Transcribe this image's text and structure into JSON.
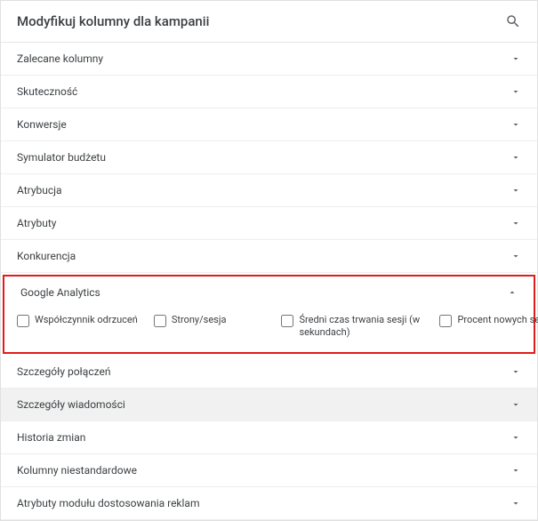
{
  "header": {
    "title": "Modyfikuj kolumny dla kampanii"
  },
  "sections": {
    "zalecane": "Zalecane kolumny",
    "skutecznosc": "Skuteczność",
    "konwersje": "Konwersje",
    "symulator": "Symulator budżetu",
    "atrybucja": "Atrybucja",
    "atrybuty": "Atrybuty",
    "konkurencja": "Konkurencja",
    "ga": "Google Analytics",
    "szczegoly_polaczen": "Szczegóły połączeń",
    "szczegoly_wiadomosci": "Szczegóły wiadomości",
    "historia": "Historia zmian",
    "kolumny_niestandardowe": "Kolumny niestandardowe",
    "atrybuty_modulu": "Atrybuty modułu dostosowania reklam"
  },
  "ga_options": {
    "opt1": "Współczynnik odrzuceń",
    "opt2": "Strony/sesja",
    "opt3": "Średni czas trwania sesji (w sekundach)",
    "opt4": "Procent nowych sesji"
  }
}
